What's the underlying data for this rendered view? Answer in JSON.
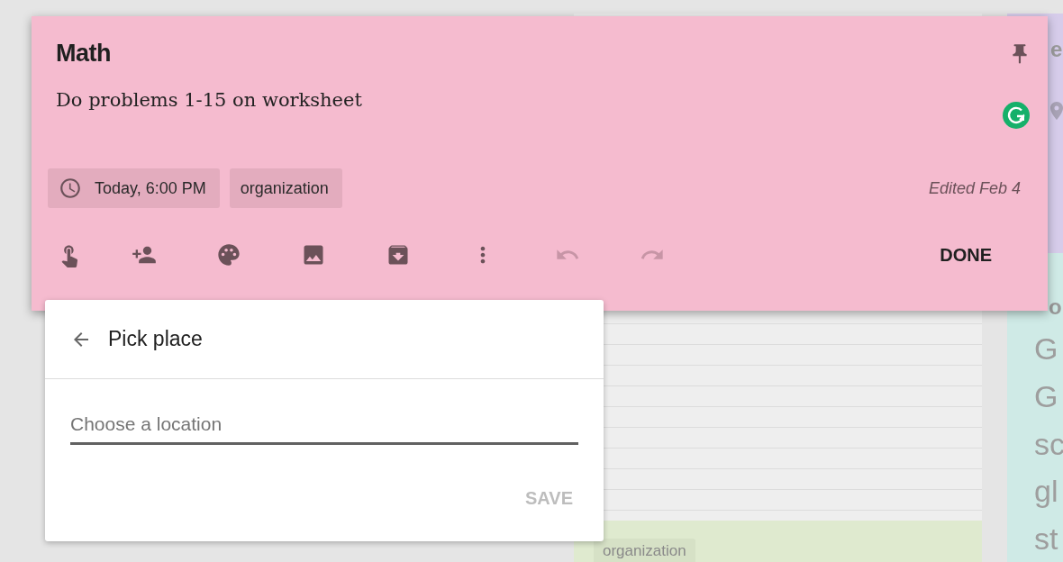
{
  "note": {
    "title": "Math",
    "pinned": true,
    "body": "Do problems 1-15 on worksheet",
    "chips": [
      {
        "kind": "reminder",
        "label": "Today, 6:00 PM"
      },
      {
        "kind": "label",
        "label": "organization"
      }
    ],
    "edited": "Edited Feb 4",
    "toolbar": [
      {
        "kind": "reminder",
        "disabled": false
      },
      {
        "kind": "collaborator",
        "disabled": false
      },
      {
        "kind": "color",
        "disabled": false
      },
      {
        "kind": "image",
        "disabled": false
      },
      {
        "kind": "archive",
        "disabled": false
      },
      {
        "kind": "more",
        "disabled": false
      },
      {
        "kind": "undo",
        "disabled": true
      },
      {
        "kind": "redo",
        "disabled": true
      }
    ],
    "done": "DONE"
  },
  "place_picker": {
    "title": "Pick place",
    "placeholder": "Choose a location",
    "save": "SAVE",
    "save_disabled": true
  },
  "background": {
    "label_card": {
      "label": "organization"
    },
    "top_card": {
      "title": "e"
    },
    "side_card": {
      "title": "o",
      "lines": [
        "G",
        "G",
        "sc",
        "gl",
        "st"
      ]
    }
  }
}
